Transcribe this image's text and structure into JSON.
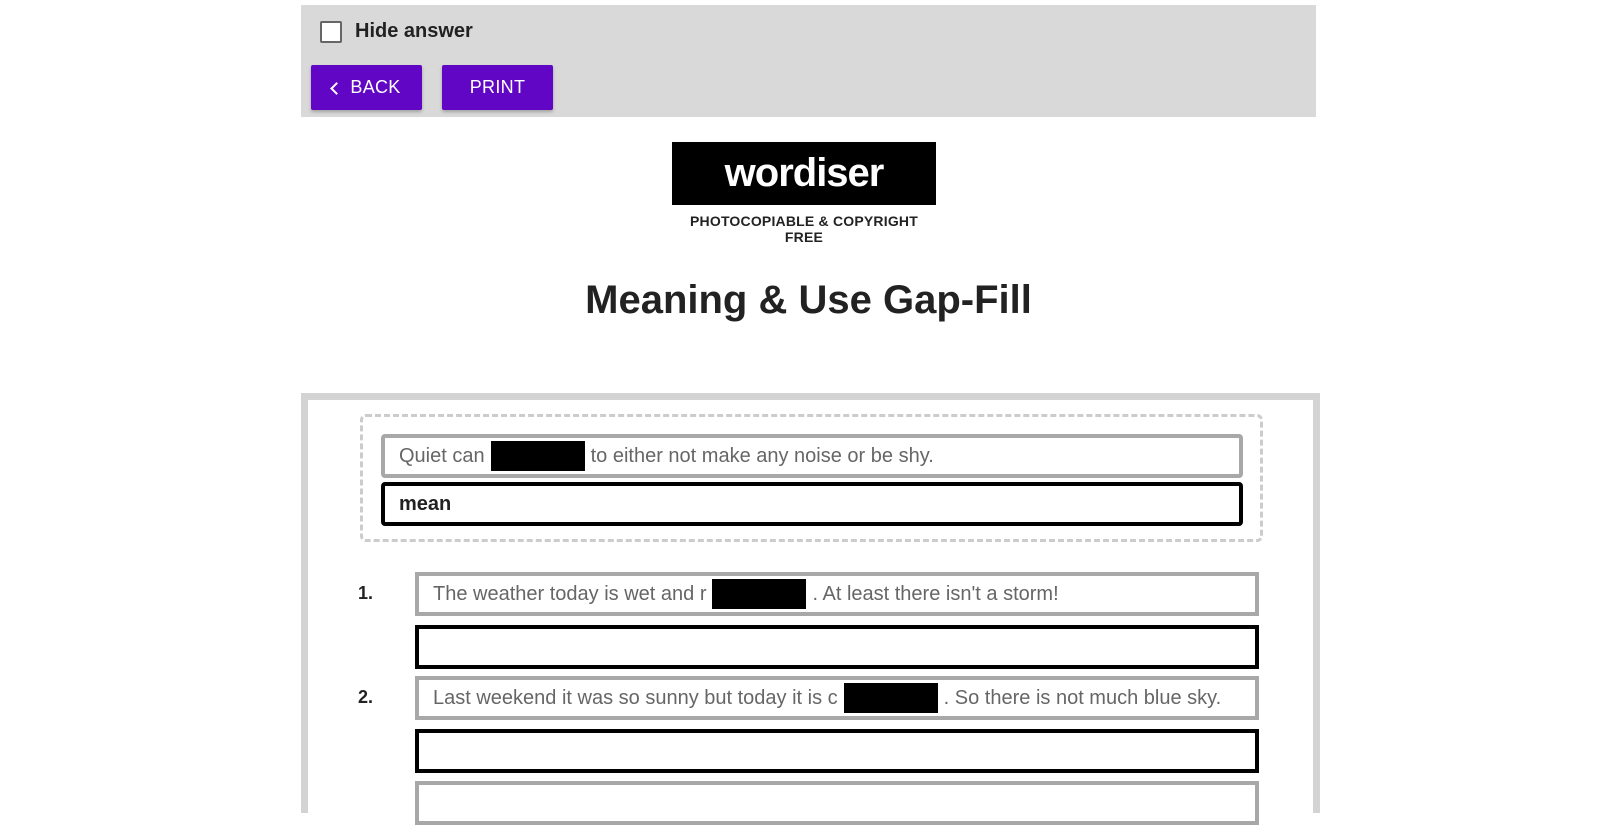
{
  "toolbar": {
    "hide_answer_label": "Hide answer",
    "back_label": "BACK",
    "print_label": "PRINT",
    "button_color": "#6106c4"
  },
  "logo": {
    "text": "wordiser",
    "subtitle": "PHOTOCOPIABLE & COPYRIGHT FREE"
  },
  "page_title": "Meaning & Use Gap-Fill",
  "example": {
    "before": "Quiet can",
    "after": "to either not make any noise or be shy.",
    "answer": "mean"
  },
  "questions": [
    {
      "number": "1.",
      "before": "The weather today is wet and r",
      "after": ". At least there isn't a storm!",
      "answer": ""
    },
    {
      "number": "2.",
      "before": "Last weekend it was so sunny but today it is c",
      "after": ". So there is not much blue sky.",
      "answer": ""
    }
  ]
}
